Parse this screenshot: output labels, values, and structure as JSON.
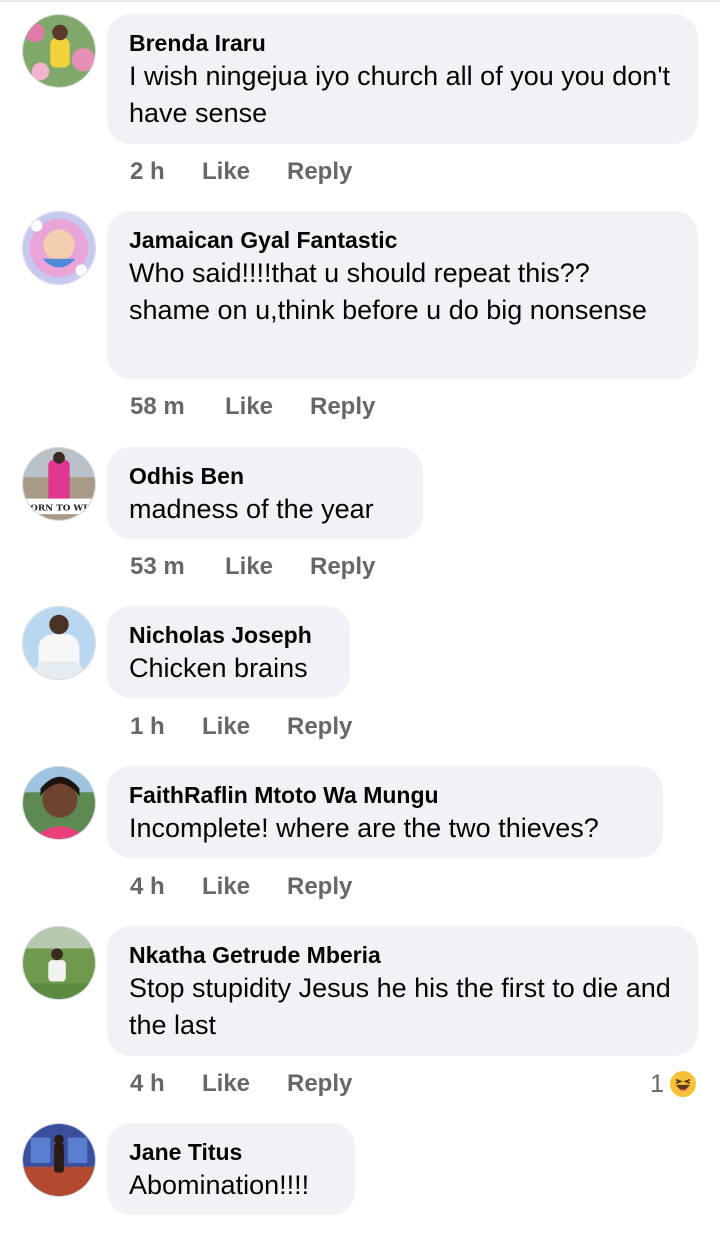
{
  "comments": [
    {
      "name": "Brenda Iraru",
      "text": "I wish ningejua iyo church all of you you don't have sense",
      "time": "2 h",
      "like": "Like",
      "reply": "Reply"
    },
    {
      "name": "Jamaican Gyal Fantastic",
      "text": "Who said!!!!that u should repeat this?? shame on u,think before u do big nonsense",
      "time": "58 m",
      "like": "Like",
      "reply": "Reply"
    },
    {
      "name": "Odhis Ben",
      "text": "madness of the year",
      "time": "53 m",
      "like": "Like",
      "reply": "Reply",
      "avatar_caption": "BORN TO WIN"
    },
    {
      "name": "Nicholas Joseph",
      "text": "Chicken brains",
      "time": "1 h",
      "like": "Like",
      "reply": "Reply"
    },
    {
      "name": "FaithRaflin Mtoto Wa Mungu",
      "text": "Incomplete! where are the two thieves?",
      "time": "4 h",
      "like": "Like",
      "reply": "Reply"
    },
    {
      "name": "Nkatha Getrude Mberia",
      "text": "Stop stupidity Jesus he his the first to die and the last",
      "time": "4 h",
      "like": "Like",
      "reply": "Reply",
      "reaction_count": "1",
      "reaction_icon": "haha-emoji-icon"
    },
    {
      "name": "Jane Titus",
      "text": "Abomination!!!!"
    }
  ],
  "colors": {
    "bubble": "#f0f2f5",
    "meta_text": "#65676b",
    "reaction": "#f7c23a"
  }
}
